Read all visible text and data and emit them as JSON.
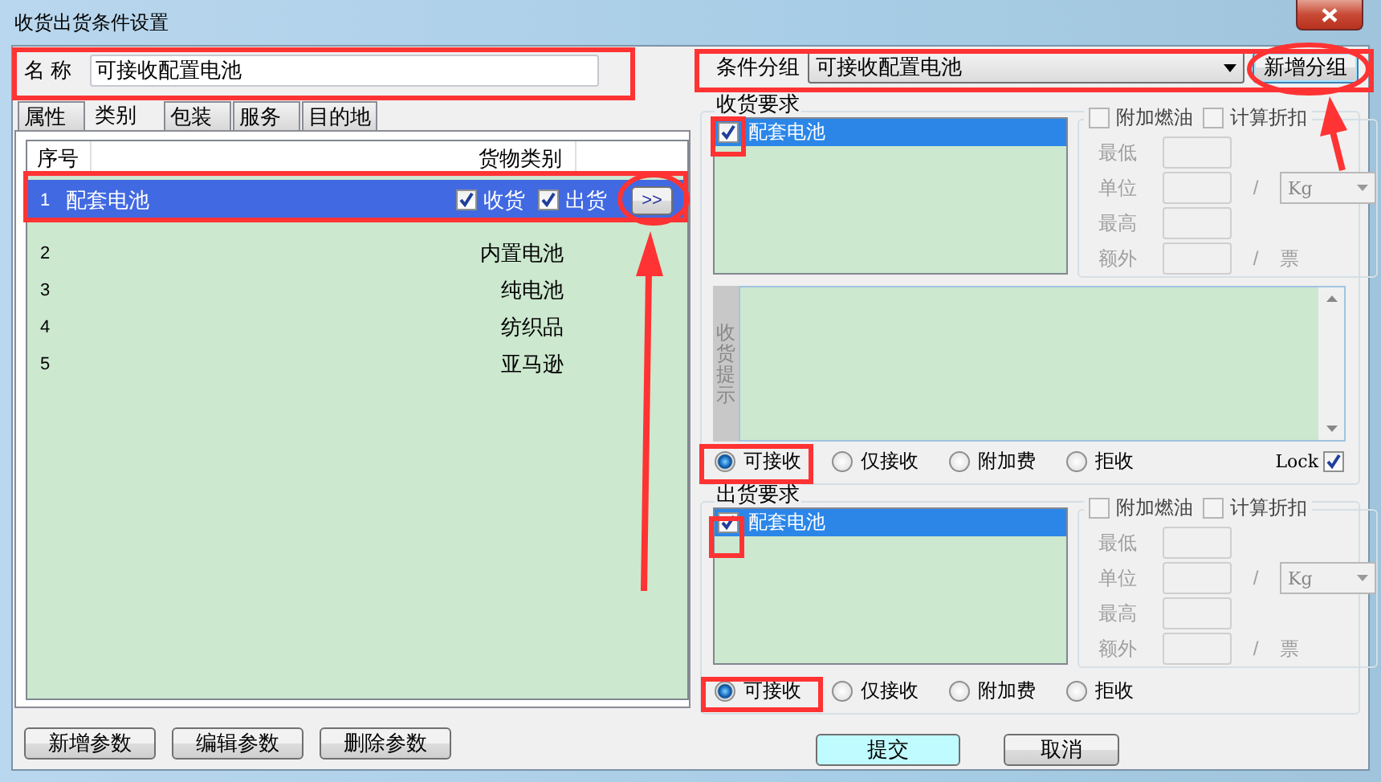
{
  "window": {
    "title": "收货出货条件设置"
  },
  "name_field": {
    "label": "名 称",
    "value": "可接收配置电池"
  },
  "tabs": [
    {
      "label": "属性",
      "selected": false
    },
    {
      "label": "类别",
      "selected": true
    },
    {
      "label": "包装",
      "selected": false
    },
    {
      "label": "服务",
      "selected": false
    },
    {
      "label": "目的地",
      "selected": false
    }
  ],
  "category_table": {
    "columns": [
      "序号",
      "货物类别"
    ],
    "rows": [
      {
        "index": "1",
        "name": "配套电池",
        "selected": true,
        "receive": {
          "label": "收货",
          "checked": true
        },
        "ship": {
          "label": "出货",
          "checked": true
        },
        "action": ">>"
      },
      {
        "index": "2",
        "name": "内置电池",
        "selected": false
      },
      {
        "index": "3",
        "name": "纯电池",
        "selected": false
      },
      {
        "index": "4",
        "name": "纺织品",
        "selected": false
      },
      {
        "index": "5",
        "name": "亚马逊",
        "selected": false
      }
    ]
  },
  "left_buttons": [
    "新增参数",
    "编辑参数",
    "删除参数"
  ],
  "condition_group": {
    "label": "条件分组",
    "value": "可接收配置电池",
    "button": "新增分组"
  },
  "receive_section": {
    "title": "收货要求",
    "items": [
      {
        "label": "配套电池",
        "checked": true,
        "selected": true
      }
    ],
    "params": {
      "disabled": true,
      "fuel": {
        "label": "附加燃油",
        "checked": false
      },
      "discount": {
        "label": "计算折扣",
        "checked": false
      },
      "fields": [
        {
          "label": "最低",
          "kind": "plain"
        },
        {
          "label": "单位",
          "kind": "unit",
          "separator": "/",
          "unit": "Kg"
        },
        {
          "label": "最高",
          "kind": "plain"
        },
        {
          "label": "额外",
          "kind": "suffix",
          "separator": "/",
          "suffix": "票"
        }
      ]
    },
    "tips": {
      "label": "收货提示"
    },
    "options": [
      {
        "label": "可接收",
        "selected": true
      },
      {
        "label": "仅接收",
        "selected": false
      },
      {
        "label": "附加费",
        "selected": false
      },
      {
        "label": "拒收",
        "selected": false
      }
    ],
    "lock": {
      "label": "Lock",
      "checked": true
    }
  },
  "ship_section": {
    "title": "出货要求",
    "items": [
      {
        "label": "配套电池",
        "checked": true,
        "selected": true
      }
    ],
    "params": {
      "disabled": true,
      "fuel": {
        "label": "附加燃油",
        "checked": false
      },
      "discount": {
        "label": "计算折扣",
        "checked": false
      },
      "fields": [
        {
          "label": "最低",
          "kind": "plain"
        },
        {
          "label": "单位",
          "kind": "unit",
          "separator": "/",
          "unit": "Kg"
        },
        {
          "label": "最高",
          "kind": "plain"
        },
        {
          "label": "额外",
          "kind": "suffix",
          "separator": "/",
          "suffix": "票"
        }
      ]
    },
    "options": [
      {
        "label": "可接收",
        "selected": true
      },
      {
        "label": "仅接收",
        "selected": false
      },
      {
        "label": "附加费",
        "selected": false
      },
      {
        "label": "拒收",
        "selected": false
      }
    ]
  },
  "footer_buttons": [
    {
      "label": "提交",
      "default": true
    },
    {
      "label": "取消",
      "default": false
    }
  ]
}
